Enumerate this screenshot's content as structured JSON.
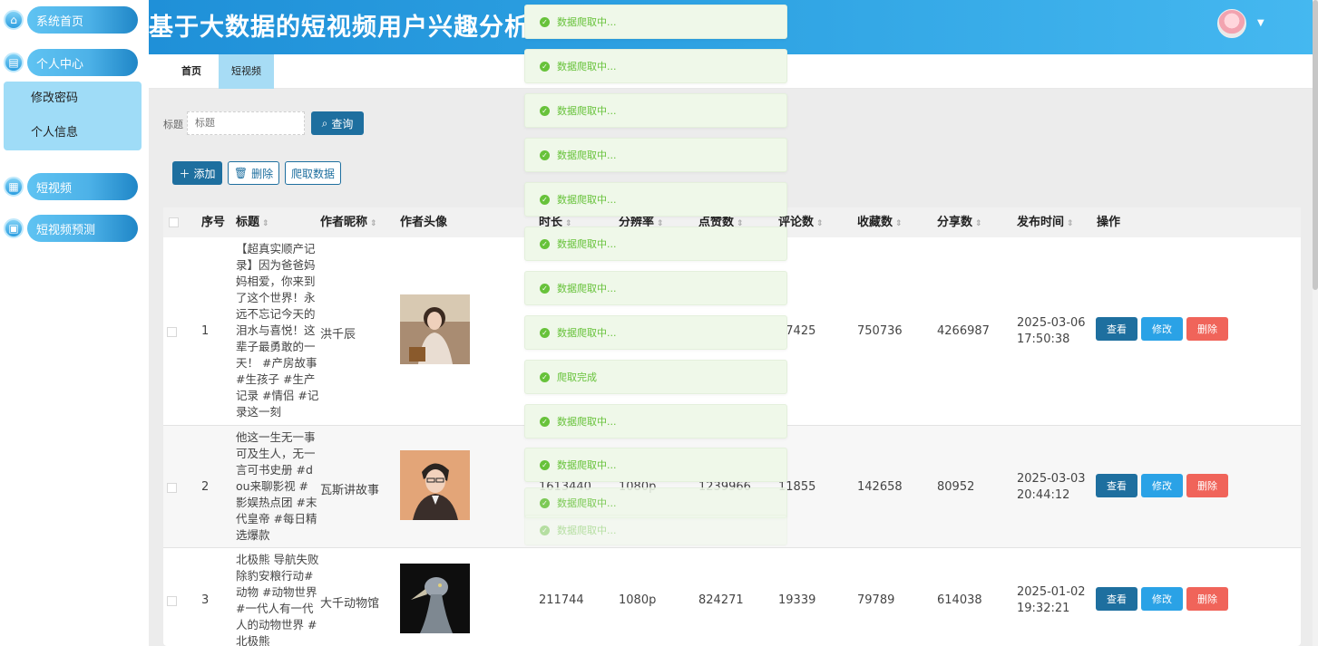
{
  "app": {
    "title": "基于大数据的短视频用户兴趣分析"
  },
  "sidebar": {
    "items": [
      {
        "label": "系统首页",
        "icon": "home-icon"
      },
      {
        "label": "个人中心",
        "icon": "profile-icon"
      },
      {
        "label": "短视频",
        "icon": "grid-icon"
      },
      {
        "label": "短视频预测",
        "icon": "briefcase-icon"
      }
    ],
    "submenu": [
      {
        "label": "修改密码"
      },
      {
        "label": "个人信息"
      }
    ]
  },
  "tabs": [
    {
      "label": "首页"
    },
    {
      "label": "短视频"
    }
  ],
  "search": {
    "label": "标题",
    "placeholder": "标题",
    "button": "查询"
  },
  "toolbar": {
    "add": "添加",
    "delete": "删除",
    "crawl": "爬取数据"
  },
  "table": {
    "headers": [
      "序号",
      "标题",
      "作者昵称",
      "作者头像",
      "时长",
      "分辨率",
      "点赞数",
      "评论数",
      "收藏数",
      "分享数",
      "发布时间",
      "操作"
    ],
    "actions": {
      "view": "查看",
      "edit": "修改",
      "delete": "删除"
    },
    "rows": [
      {
        "index": "1",
        "title": "【超真实顺产记录】因为爸爸妈妈相爱，你来到了这个世界！永远不忘记今天的泪水与喜悦！这辈子最勇敢的一天！ #产房故事 #生孩子 #生产记录 #情侣 #记录这一刻",
        "author": "洪千辰",
        "duration": "",
        "resolution": "",
        "likes": "",
        "comments": "07425",
        "favorites": "750736",
        "shares": "4266987",
        "publish_time": "2025-03-06 17:50:38"
      },
      {
        "index": "2",
        "title": "他这一生无一事可及生人，无一言可书史册 #dou来聊影视 #影娱热点团 #末代皇帝 #每日精选爆款",
        "author": "瓦斯讲故事",
        "duration": "1613440",
        "resolution": "1080p",
        "likes": "1239966",
        "comments": "11855",
        "favorites": "142658",
        "shares": "80952",
        "publish_time": "2025-03-03 20:44:12"
      },
      {
        "index": "3",
        "title": "北极熊 导航失败除豹安粮行动#动物 #动物世界 #一代人有一代人的动物世界 #北极熊",
        "author": "大千动物馆",
        "duration": "211744",
        "resolution": "1080p",
        "likes": "824271",
        "comments": "19339",
        "favorites": "79789",
        "shares": "614038",
        "publish_time": "2025-01-02 19:32:21"
      }
    ]
  },
  "notifications": [
    {
      "text": "数据爬取中..."
    },
    {
      "text": "数据爬取中..."
    },
    {
      "text": "数据爬取中..."
    },
    {
      "text": "数据爬取中..."
    },
    {
      "text": "数据爬取中..."
    },
    {
      "text": "数据爬取中..."
    },
    {
      "text": "数据爬取中..."
    },
    {
      "text": "数据爬取中..."
    },
    {
      "text": "爬取完成"
    },
    {
      "text": "数据爬取中..."
    },
    {
      "text": "数据爬取中..."
    },
    {
      "text": "数据爬取中..."
    },
    {
      "text": "数据爬取中..."
    }
  ],
  "colors": {
    "header": "#2fa3e3",
    "primary": "#1e6f9f",
    "edit": "#2aa2e6",
    "danger": "#f0645a",
    "success": "#67c23a"
  }
}
